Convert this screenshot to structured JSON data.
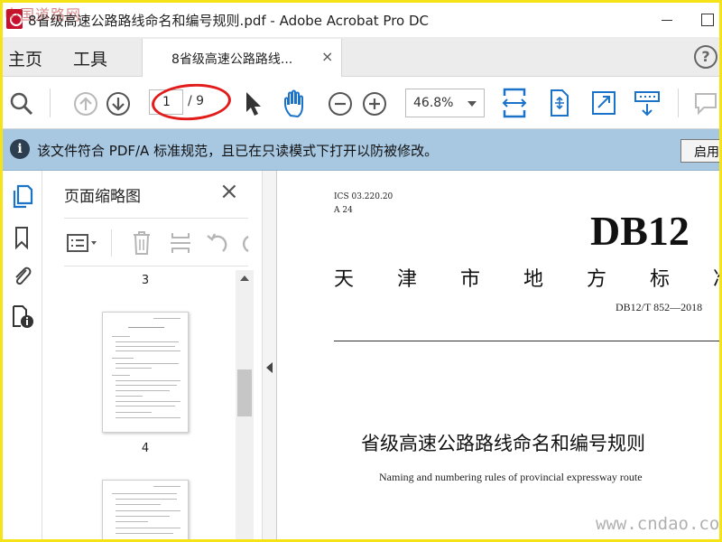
{
  "window": {
    "title": "8省级高速公路路线命名和编号规则.pdf - Adobe Acrobat Pro DC",
    "watermark_top": "中国道路网"
  },
  "tabs": {
    "home": "主页",
    "tools": "工具",
    "document_tab": "8省级高速公路路线...",
    "close_symbol": "×",
    "help_symbol": "?"
  },
  "toolbar": {
    "page_current": "1",
    "page_total": "/ 9",
    "zoom": "46.8%"
  },
  "banner": {
    "message": "该文件符合 PDF/A 标准规范，且已在只读模式下打开以防被修改。",
    "button": "启用",
    "icon": "i"
  },
  "thumbnails": {
    "title": "页面缩略图",
    "close_symbol": "×",
    "pages": [
      {
        "number": "3"
      },
      {
        "number": "4"
      }
    ]
  },
  "document": {
    "ics": "ICS 03.220.20",
    "class": "A 24",
    "db_code": "DB12",
    "standard_chars": [
      "天",
      "津",
      "市",
      "地",
      "方",
      "标",
      "准"
    ],
    "standard_number": "DB12/T 852—2018",
    "title_cn": "省级高速公路路线命名和编号规则",
    "title_en": "Naming and numbering rules of provincial expressway route",
    "watermark": "www.cndao.com"
  },
  "colors": {
    "border": "#f5e317",
    "banner": "#a8c8e2",
    "accent_blue": "#1a73c9",
    "annotation_red": "#e21b1b"
  }
}
